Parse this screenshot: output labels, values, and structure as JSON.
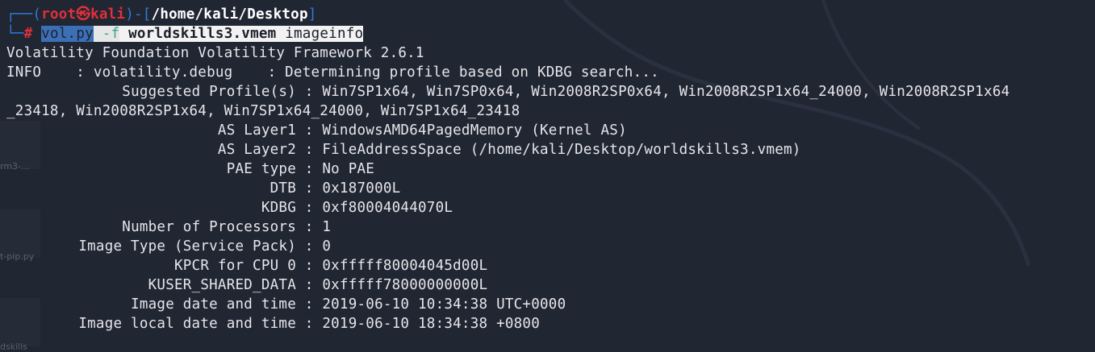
{
  "prompt": {
    "top_left": "┌──(",
    "user": "root",
    "at_symbol": "㉿",
    "host": "kali",
    "mid": ")-[",
    "path": "/home/kali/Desktop",
    "end": "]",
    "bottom_left": "└─",
    "hash": "#"
  },
  "command": {
    "program": "vol.py",
    "flag": "-f",
    "file": "worldskills3.vmem",
    "plugin": "imageinfo"
  },
  "output": {
    "banner": "Volatility Foundation Volatility Framework 2.6.1",
    "info_line": "INFO    : volatility.debug    : Determining profile based on KDBG search...",
    "rows": [
      {
        "label": "Suggested Profile(s)",
        "value": "Win7SP1x64, Win7SP0x64, Win2008R2SP0x64, Win2008R2SP1x64_24000, Win2008R2SP1x64"
      },
      {
        "label": "",
        "value": "_23418, Win2008R2SP1x64, Win7SP1x64_24000, Win7SP1x64_23418"
      },
      {
        "label": "AS Layer1",
        "value": "WindowsAMD64PagedMemory (Kernel AS)"
      },
      {
        "label": "AS Layer2",
        "value": "FileAddressSpace (/home/kali/Desktop/worldskills3.vmem)"
      },
      {
        "label": "PAE type",
        "value": "No PAE"
      },
      {
        "label": "DTB",
        "value": "0x187000L"
      },
      {
        "label": "KDBG",
        "value": "0xf80004044070L"
      },
      {
        "label": "Number of Processors",
        "value": "1"
      },
      {
        "label": "Image Type (Service Pack)",
        "value": "0"
      },
      {
        "label": "KPCR for CPU 0",
        "value": "0xfffff80004045d00L"
      },
      {
        "label": "KUSER_SHARED_DATA",
        "value": "0xfffff78000000000L"
      },
      {
        "label": "Image date and time",
        "value": "2019-06-10 10:34:38 UTC+0000"
      },
      {
        "label": "Image local date and time",
        "value": "2019-06-10 18:34:38 +0800"
      }
    ]
  },
  "desktop_labels": [
    "rm3-...",
    "t-pip.py",
    "dskills"
  ],
  "colors": {
    "background": "#212633",
    "prompt_blue": "#2f7bd8",
    "prompt_red": "#e0303a",
    "text": "#e6e6ea"
  }
}
